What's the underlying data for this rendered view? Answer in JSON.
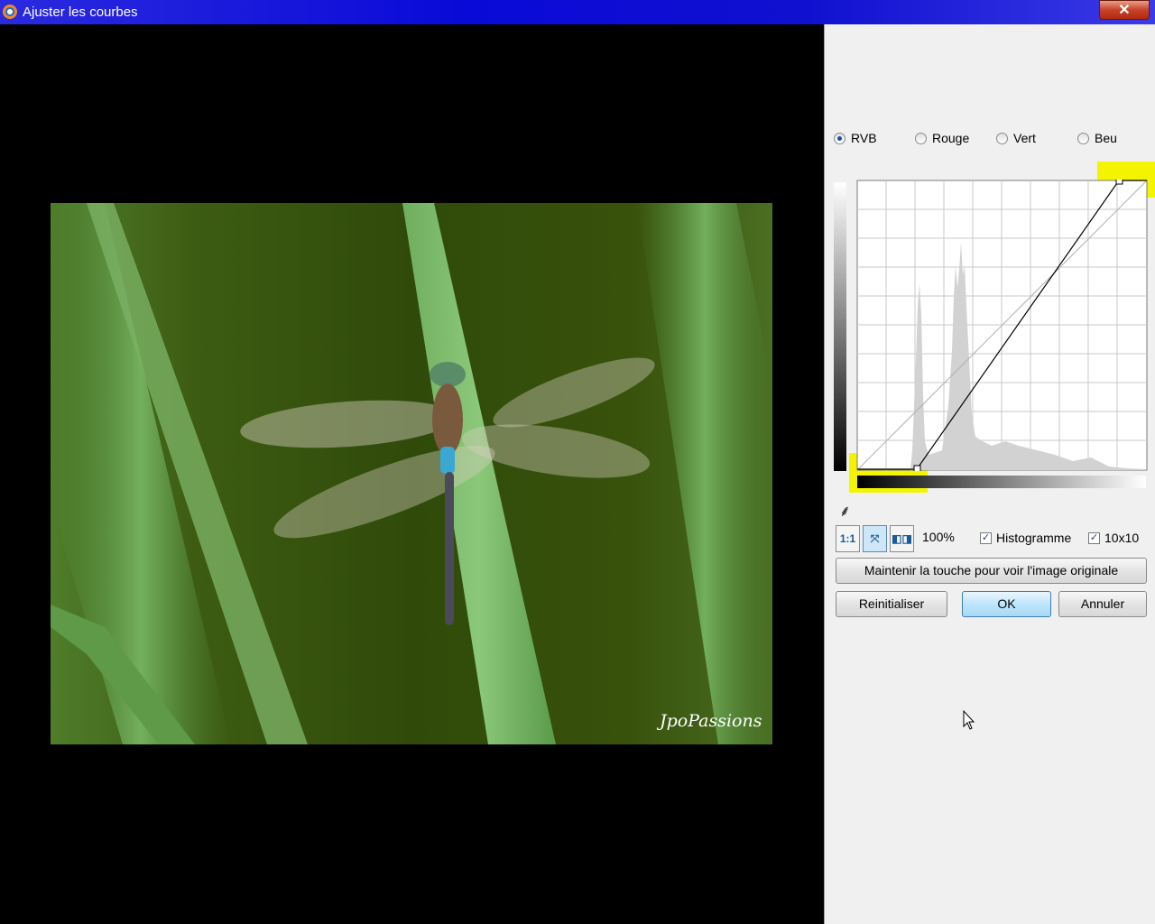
{
  "window": {
    "title": "Ajuster les courbes",
    "close_label": "✕"
  },
  "photo": {
    "watermark": "JpoPassions",
    "description_icon": "dragonfly-photo"
  },
  "channels": {
    "selected": "RVB",
    "options": [
      {
        "label": "RVB",
        "checked": true
      },
      {
        "label": "Rouge",
        "checked": false
      },
      {
        "label": "Vert",
        "checked": false
      },
      {
        "label": "Beu",
        "checked": false
      }
    ]
  },
  "curve": {
    "grid": "10x10",
    "points_input_output": [
      [
        0,
        0
      ],
      [
        52,
        0
      ],
      [
        233,
        255
      ],
      [
        255,
        255
      ]
    ]
  },
  "toolbar": {
    "ratio_label": "1:1",
    "fit_icon": "fit-to-window-icon",
    "compare_icon": "split-view-icon",
    "zoom": "100%"
  },
  "options": {
    "histogram_label": "Histogramme",
    "histogram_checked": true,
    "grid_label": "10x10",
    "grid_checked": true
  },
  "buttons": {
    "hold_original": "Maintenir la touche pour voir l'image originale",
    "reset": "Reinitialiser",
    "ok": "OK",
    "cancel": "Annuler"
  },
  "colors": {
    "titlebar": "#0a0ad8",
    "highlight": "#f4f400",
    "panel": "#f0f0f0"
  }
}
